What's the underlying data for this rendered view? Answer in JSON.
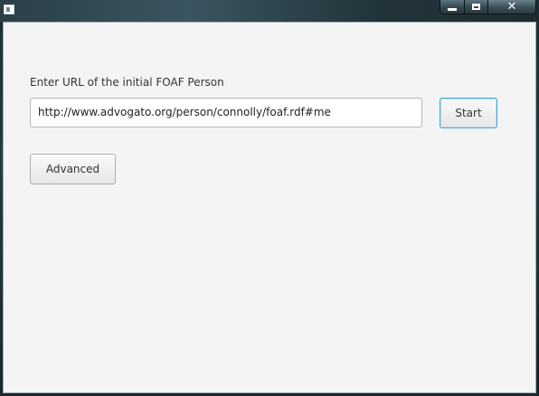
{
  "window": {
    "title": "",
    "app_icon": "java-app-icon",
    "controls": {
      "minimize_icon": "minimize-icon",
      "maximize_icon": "maximize-icon",
      "close_glyph": "✕"
    }
  },
  "form": {
    "url_label": "Enter URL of the initial FOAF Person",
    "url_value": "http://www.advogato.org/person/connolly/foaf.rdf#me",
    "start_label": "Start",
    "advanced_label": "Advanced"
  },
  "colors": {
    "accent": "#3fa5d8",
    "background": "#f4f4f4",
    "text": "#333333"
  }
}
